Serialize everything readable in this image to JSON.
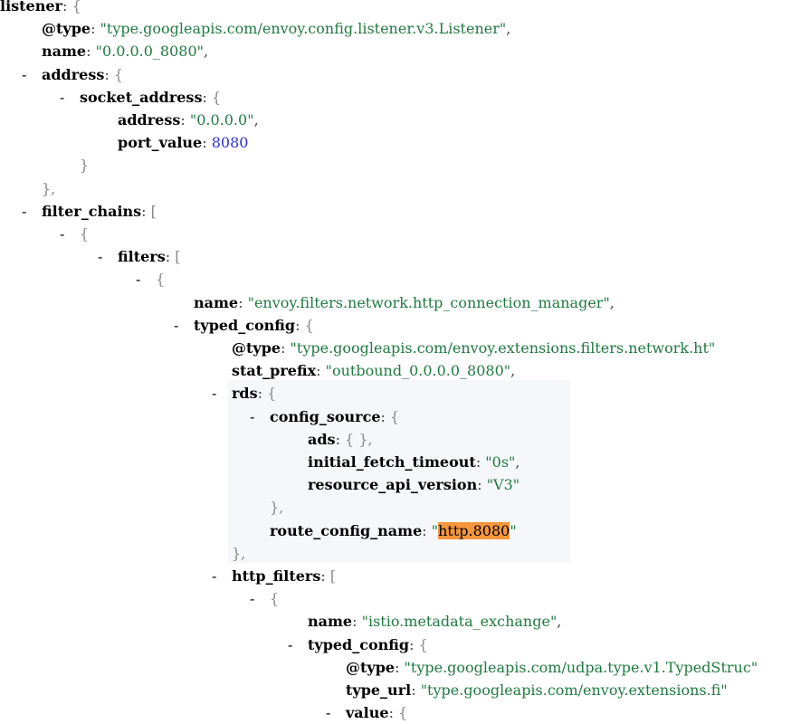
{
  "lines": [
    {
      "id": "l0",
      "indent": 0,
      "dash": false,
      "key": "listener",
      "open": "{"
    },
    {
      "id": "l1",
      "indent": 46,
      "dash": false,
      "key": "@type",
      "str": "type.googleapis.com/envoy.config.listener.v3.Listener",
      "comma": true
    },
    {
      "id": "l2",
      "indent": 46,
      "dash": false,
      "key": "name",
      "str": "0.0.0.0_8080",
      "comma": true
    },
    {
      "id": "l3",
      "indent": 46,
      "dash": true,
      "key": "address",
      "open": "{"
    },
    {
      "id": "l4",
      "indent": 88,
      "dash": true,
      "key": "socket_address",
      "open": "{"
    },
    {
      "id": "l5",
      "indent": 130,
      "dash": false,
      "key": "address",
      "str": "0.0.0.0",
      "comma": true
    },
    {
      "id": "l6",
      "indent": 130,
      "dash": false,
      "key": "port_value",
      "num": "8080"
    },
    {
      "id": "l7",
      "indent": 88,
      "dash": false,
      "close": "}"
    },
    {
      "id": "l8",
      "indent": 46,
      "dash": false,
      "close": "},"
    },
    {
      "id": "l9",
      "indent": 46,
      "dash": true,
      "key": "filter_chains",
      "open": "["
    },
    {
      "id": "l10",
      "indent": 88,
      "dash": true,
      "open": "{"
    },
    {
      "id": "l11",
      "indent": 130,
      "dash": true,
      "key": "filters",
      "open": "["
    },
    {
      "id": "l12",
      "indent": 172,
      "dash": true,
      "open": "{"
    },
    {
      "id": "l13",
      "indent": 214,
      "dash": false,
      "key": "name",
      "str": "envoy.filters.network.http_connection_manager",
      "comma": true
    },
    {
      "id": "l14",
      "indent": 214,
      "dash": true,
      "key": "typed_config",
      "open": "{"
    },
    {
      "id": "l15",
      "indent": 256,
      "dash": false,
      "key": "@type",
      "str": "type.googleapis.com/envoy.extensions.filters.network.ht"
    },
    {
      "id": "l16",
      "indent": 256,
      "dash": false,
      "key": "stat_prefix",
      "str": "outbound_0.0.0.0_8080",
      "comma": true
    },
    {
      "id": "l17",
      "indent": 256,
      "dash": true,
      "key": "rds",
      "open": "{"
    },
    {
      "id": "l18",
      "indent": 298,
      "dash": true,
      "key": "config_source",
      "open": "{"
    },
    {
      "id": "l19",
      "indent": 340,
      "dash": false,
      "key": "ads",
      "open": "{ },"
    },
    {
      "id": "l20",
      "indent": 340,
      "dash": false,
      "key": "initial_fetch_timeout",
      "str": "0s",
      "comma": true
    },
    {
      "id": "l21",
      "indent": 340,
      "dash": false,
      "key": "resource_api_version",
      "str": "V3"
    },
    {
      "id": "l22",
      "indent": 298,
      "dash": false,
      "close": "},"
    },
    {
      "id": "l23",
      "indent": 298,
      "dash": false,
      "key": "route_config_name",
      "str": "http.8080",
      "highlight": true
    },
    {
      "id": "l24",
      "indent": 256,
      "dash": false,
      "close": "},"
    },
    {
      "id": "l25",
      "indent": 256,
      "dash": true,
      "key": "http_filters",
      "open": "["
    },
    {
      "id": "l26",
      "indent": 298,
      "dash": true,
      "open": "{"
    },
    {
      "id": "l27",
      "indent": 340,
      "dash": false,
      "key": "name",
      "str": "istio.metadata_exchange",
      "comma": true
    },
    {
      "id": "l28",
      "indent": 340,
      "dash": true,
      "key": "typed_config",
      "open": "{"
    },
    {
      "id": "l29",
      "indent": 382,
      "dash": false,
      "key": "@type",
      "str": "type.googleapis.com/udpa.type.v1.TypedStruc"
    },
    {
      "id": "l30",
      "indent": 382,
      "dash": false,
      "key": "type_url",
      "str": "type.googleapis.com/envoy.extensions.fi"
    },
    {
      "id": "l31",
      "indent": 382,
      "dash": true,
      "key": "value",
      "open": "{"
    }
  ],
  "colors": {
    "string": "#1f7a40",
    "number": "#2c2fd8",
    "key": "#000000",
    "search_match": "#f5963a",
    "hover_block": "#f6f7fa"
  }
}
